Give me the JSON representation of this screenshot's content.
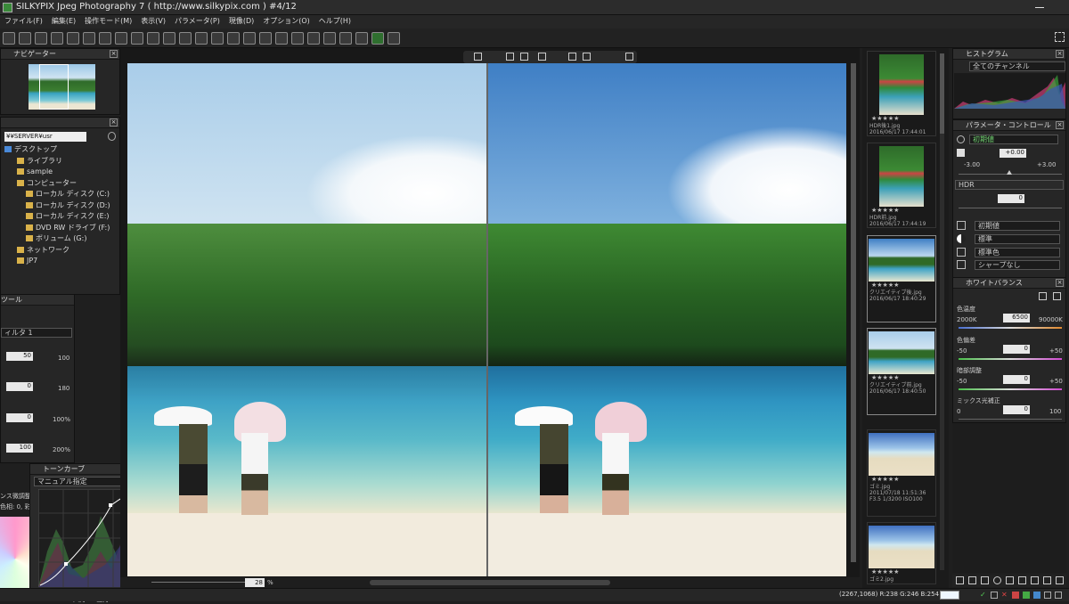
{
  "window": {
    "title": "SILKYPIX Jpeg Photography 7 ( http://www.silkypix.com )   #4/12"
  },
  "menu": [
    "ファイル(F)",
    "編集(E)",
    "操作モード(M)",
    "表示(V)",
    "パラメータ(P)",
    "現像(D)",
    "オプション(O)",
    "ヘルプ(H)"
  ],
  "navigator": {
    "title": "ナビゲーター"
  },
  "folder": {
    "path": "¥¥SERVER¥usr",
    "items": [
      {
        "label": "デスクトップ",
        "indent": 0
      },
      {
        "label": "ライブラリ",
        "indent": 1
      },
      {
        "label": "sample",
        "indent": 1
      },
      {
        "label": "コンピューター",
        "indent": 1
      },
      {
        "label": "ローカル ディスク (C:)",
        "indent": 2
      },
      {
        "label": "ローカル ディスク (D:)",
        "indent": 2
      },
      {
        "label": "ローカル ディスク (E:)",
        "indent": 2
      },
      {
        "label": "DVD RW ドライブ (F:)",
        "indent": 2
      },
      {
        "label": "ボリューム (G:)",
        "indent": 2
      },
      {
        "label": "ネットワーク",
        "indent": 1
      },
      {
        "label": "JP7",
        "indent": 1
      }
    ]
  },
  "tool": {
    "title": "ツール",
    "filter": "ィルタ 1",
    "values": [
      "50",
      "0",
      "0",
      "100"
    ],
    "right": [
      "100",
      "180",
      "100%",
      "200%"
    ],
    "partial1": "ンス微調整",
    "partial2": "色相: 0, 彩"
  },
  "tonecurve": {
    "title": "トーンカーブ",
    "preset": "マニュアル指定",
    "bottom": [
      "入力",
      "出力"
    ]
  },
  "viewer": {
    "zoom": "28",
    "zoom_unit": "%"
  },
  "thumbs": [
    {
      "name": "HDR後1.jpg",
      "date": "2016/06/17 17:44:01"
    },
    {
      "name": "HDR前.jpg",
      "date": "2016/06/17 17:44:19"
    },
    {
      "name": "クリエイティブ後.jpg",
      "date": "2016/06/17 18:40:29"
    },
    {
      "name": "クリエイティブ前.jpg",
      "date": "2016/06/17 18:40:50"
    },
    {
      "name": "ゴミ.jpg",
      "date": "2011/07/18 11:51:36",
      "extra": "F3.5 1/3200 ISO100"
    },
    {
      "name": "ゴミ2.jpg",
      "date": ""
    }
  ],
  "histogram": {
    "title": "ヒストグラム",
    "channel": "全てのチャンネル"
  },
  "params": {
    "title": "パラメータ・コントロール",
    "preset": "初期値",
    "exposure": "+0.00",
    "exp_min": "-3.00",
    "exp_max": "+3.00",
    "hdr_label": "HDR",
    "hdr_value": "0",
    "rows": [
      "初期値",
      "標準",
      "標準色",
      "シャープなし"
    ]
  },
  "wb": {
    "title": "ホワイトバランス",
    "temp_label": "色温度",
    "temp_min": "2000K",
    "temp_value": "6500",
    "temp_max": "90000K",
    "tint_label": "色偏差",
    "tint_min": "-50",
    "tint_value": "0",
    "tint_max": "+50",
    "dark_label": "暗部調整",
    "dark_min": "-50",
    "dark_value": "0",
    "dark_max": "+50",
    "mix_label": "ミックス光補正",
    "mix_min": "0",
    "mix_value": "0",
    "mix_max": "100"
  },
  "status": {
    "coords": "(2267,1068) R:238 G:246 B:254"
  },
  "colors": {
    "sky_top": "#a9cde9",
    "sea": "#2f8fb0",
    "accent": "#4fa3e0"
  }
}
